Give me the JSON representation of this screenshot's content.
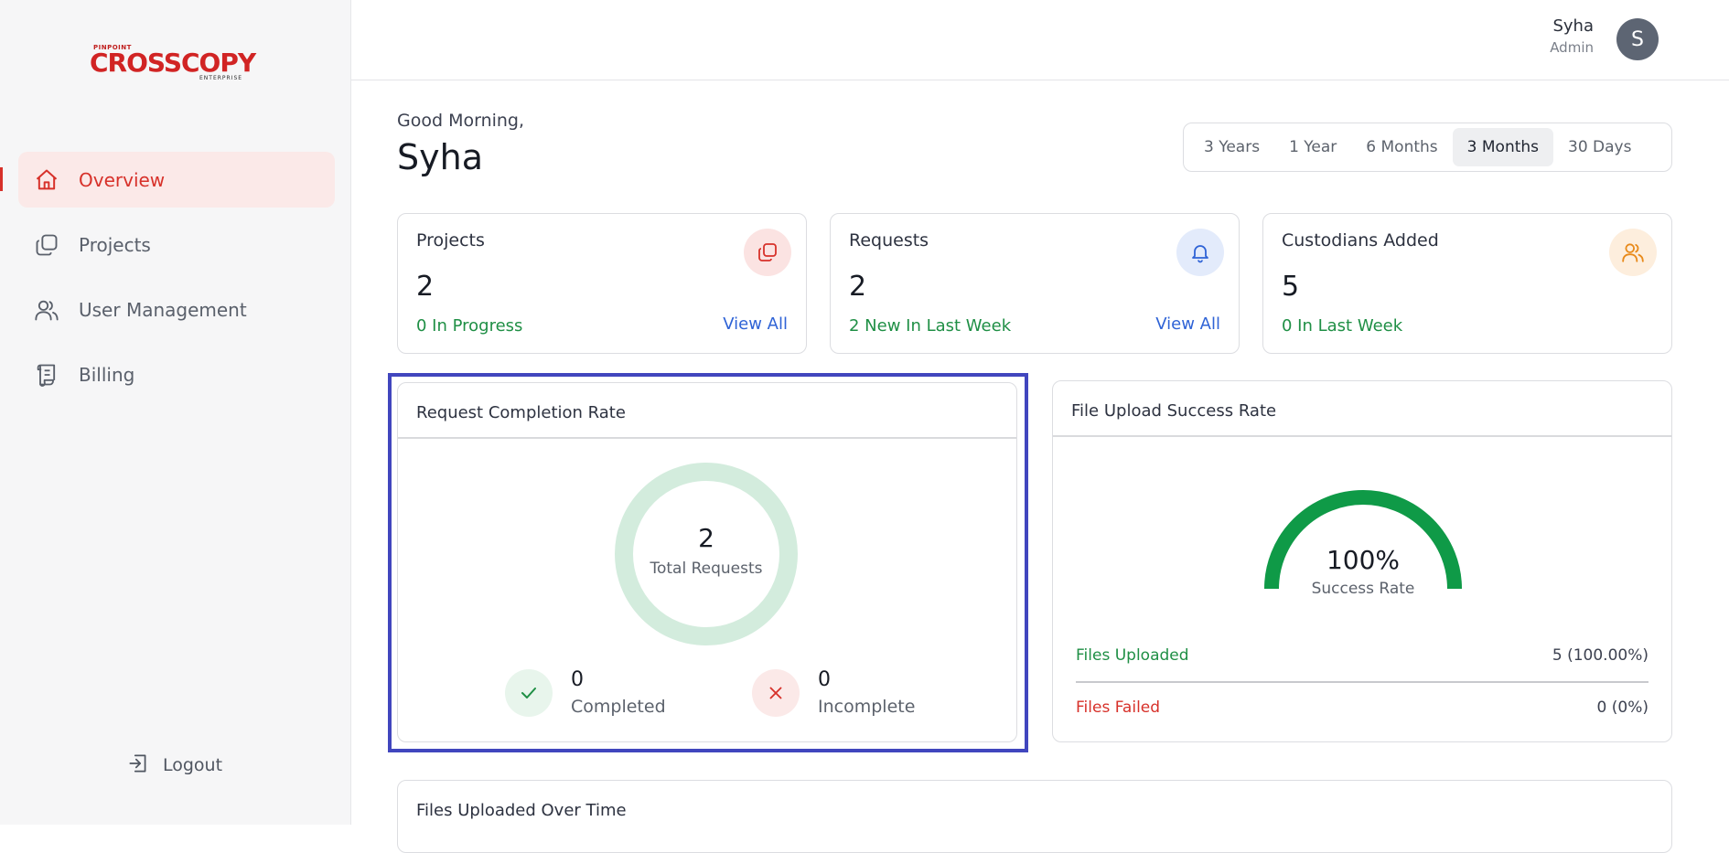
{
  "sidebar": {
    "logo": {
      "top_text": "PINPOINT",
      "main_text": "CROSSCOPY",
      "sub_text": "ENTERPRISE"
    },
    "items": [
      {
        "label": "Overview",
        "icon": "home-icon",
        "active": true
      },
      {
        "label": "Projects",
        "icon": "copy-icon",
        "active": false
      },
      {
        "label": "User Management",
        "icon": "users-icon",
        "active": false
      },
      {
        "label": "Billing",
        "icon": "receipt-icon",
        "active": false
      }
    ],
    "logout": {
      "label": "Logout",
      "icon": "logout-icon"
    }
  },
  "header": {
    "user_name": "Syha",
    "user_role": "Admin",
    "avatar_letter": "S"
  },
  "main": {
    "greeting": "Good Morning,",
    "user_name": "Syha",
    "time_ranges": [
      "3 Years",
      "1 Year",
      "6 Months",
      "3 Months",
      "30 Days"
    ],
    "selected_range": "3 Months",
    "stats": [
      {
        "title": "Projects",
        "value": "2",
        "sub": "0 In Progress",
        "link": "View All",
        "icon": "copy-icon",
        "color": "#d7312a"
      },
      {
        "title": "Requests",
        "value": "2",
        "sub": "2 New In Last Week",
        "link": "View All",
        "icon": "bell-icon",
        "color": "#2f63d6"
      },
      {
        "title": "Custodians Added",
        "value": "5",
        "sub": "0 In Last Week",
        "link": "",
        "icon": "users-icon",
        "color": "#e88a1a"
      }
    ],
    "completion": {
      "title": "Request Completion Rate",
      "total": "2",
      "total_label": "Total Requests",
      "completed": "0",
      "completed_label": "Completed",
      "incomplete": "0",
      "incomplete_label": "Incomplete"
    },
    "upload": {
      "title": "File Upload Success Rate",
      "rate": "100%",
      "rate_label": "Success Rate",
      "rate_fraction": 1.0,
      "uploaded_label": "Files Uploaded",
      "uploaded_value": "5 (100.00%)",
      "failed_label": "Files Failed",
      "failed_value": "0 (0%)"
    },
    "files_over_time": {
      "title": "Files Uploaded Over Time"
    }
  },
  "colors": {
    "accent": "#d7312a",
    "success": "#1f8f45",
    "link": "#2f63d6",
    "gauge": "#0f9a47",
    "highlight": "#4146be"
  }
}
